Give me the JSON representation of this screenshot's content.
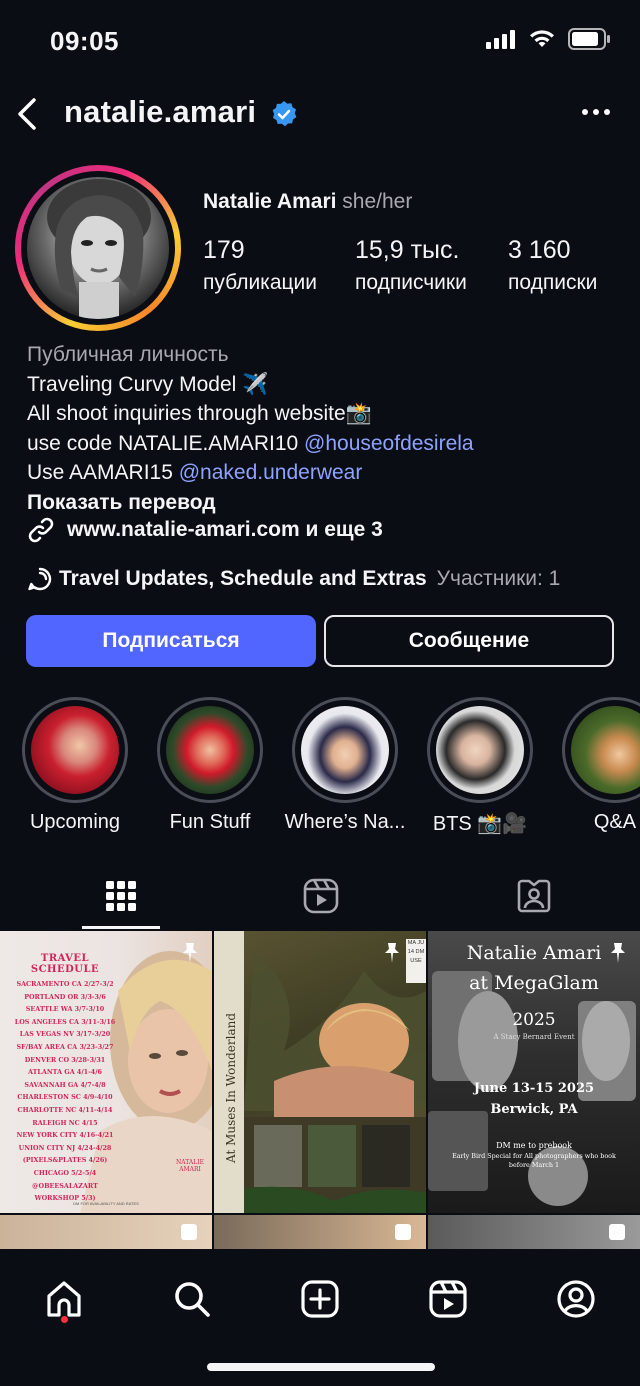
{
  "status_bar": {
    "time": "09:05"
  },
  "header": {
    "username": "natalie.amari"
  },
  "profile": {
    "display_name": "Natalie Amari",
    "pronouns": "she/her",
    "stats": [
      {
        "value": "179",
        "label": "публикации"
      },
      {
        "value": "15,9 тыс.",
        "label": "подписчики"
      },
      {
        "value": "3 160",
        "label": "подписки"
      }
    ]
  },
  "bio": {
    "category": "Публичная личность",
    "line1": "Traveling Curvy Model ✈️",
    "line2": "All shoot inquiries through website📸",
    "line3_prefix": "use code NATALIE.AMARI10 ",
    "line3_mention": "@houseofdesirela",
    "line4_prefix": "Use AAMARI15 ",
    "line4_mention": "@naked.underwear",
    "translate": "Показать перевод",
    "link": "www.natalie-amari.com и еще 3"
  },
  "channel": {
    "title": "Travel Updates, Schedule and Extras",
    "members": "Участники: 1"
  },
  "actions": {
    "follow_label": "Подписаться",
    "message_label": "Сообщение"
  },
  "highlights": [
    {
      "label": "Upcoming"
    },
    {
      "label": "Fun Stuff"
    },
    {
      "label": "Where’s Na..."
    },
    {
      "label": "BTS 📸🎥"
    },
    {
      "label": "Q&A"
    }
  ],
  "posts": {
    "post1": {
      "title": "TRAVEL SCHEDULE",
      "lines": [
        "SACRAMENTO CA 2/27-3/2",
        "PORTLAND OR 3/3-3/6",
        "SEATTLE WA 3/7-3/10",
        "LOS ANGELES CA 3/11-3/16",
        "LAS VEGAS NV 3/17-3/20",
        "SF/BAY AREA CA 3/23-3/27",
        "DENVER CO 3/28-3/31",
        "ATLANTA GA 4/1-4/6",
        "SAVANNAH GA 4/7-4/8",
        "CHARLESTON SC 4/9-4/10",
        "CHARLOTTE NC 4/11-4/14",
        "RALEIGH NC 4/15",
        "NEW YORK CITY 4/16-4/21",
        "UNION CITY NJ 4/24-4/28",
        "(PIXELS&PLATES 4/26)",
        "CHICAGO 5/2-5/4 @OBEESALAZART",
        "WORKSHOP 5/3)"
      ],
      "footer": "DM FOR AVAILABILITY AND RATES",
      "signature": "NATALIE AMARI"
    },
    "post2": {
      "vertical_text": "At Muses In Wonderland",
      "corner_text": "MA JU 14 DM USE"
    },
    "post3": {
      "title1": "Natalie Amari",
      "title2": "at MegaGlam",
      "year": "2025",
      "subtitle": "A Stacy Bernard Event",
      "dates": "June 13-15 2025",
      "place": "Berwick, PA",
      "dm": "DM me to prebook",
      "note": "Early Bird Special for All photographers who book before March 1"
    }
  },
  "colors": {
    "accent": "#5066ff",
    "mention": "#8ea2ff",
    "background": "#0b0d14",
    "notification_dot": "#ff3040"
  },
  "icons": {
    "tabs": [
      "grid-icon",
      "reels-icon",
      "tagged-icon"
    ],
    "bottom_nav": [
      "home-icon",
      "search-icon",
      "create-icon",
      "reels-icon",
      "profile-icon"
    ]
  }
}
